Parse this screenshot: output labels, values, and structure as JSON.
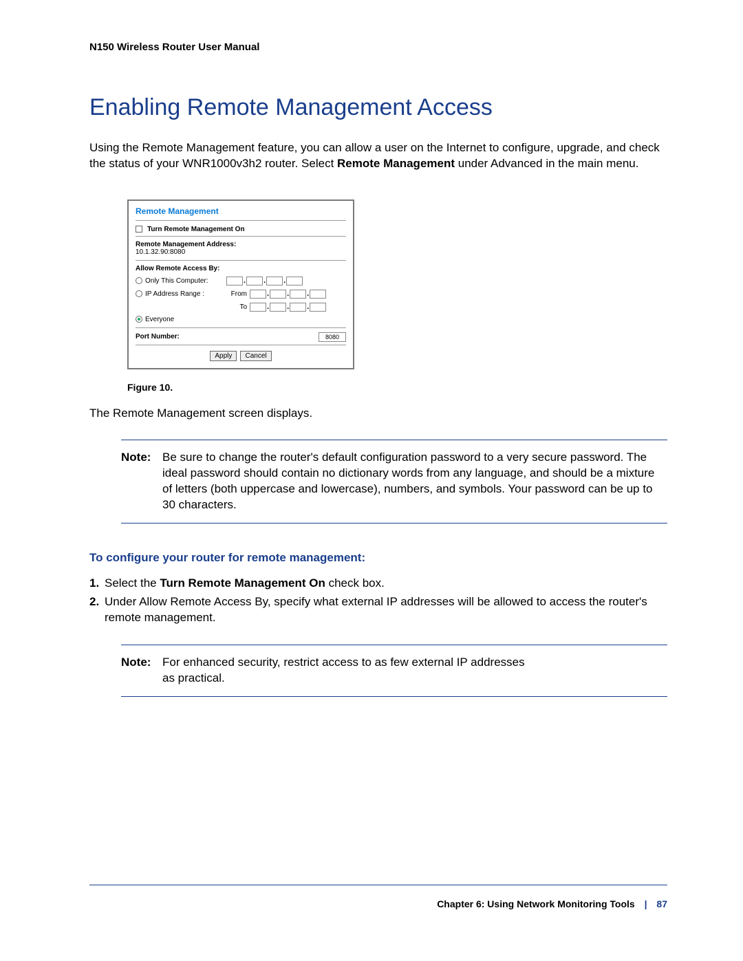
{
  "header": {
    "title": "N150 Wireless Router User Manual"
  },
  "section": {
    "title": "Enabling Remote Management Access"
  },
  "intro": {
    "pre": "Using the Remote Management feature, you can allow a user on the Internet to configure, upgrade, and check the status of your WNR1000v3h2 router. Select ",
    "bold": "Remote Management",
    "post": " under Advanced in the main menu."
  },
  "panel": {
    "title": "Remote Management",
    "turn_on_label": "Turn Remote Management On",
    "addr_label": "Remote Management Address:",
    "addr_value": "10.1.32.90:8080",
    "allow_label": "Allow Remote Access By:",
    "only_this": "Only This Computer:",
    "ip_range": "IP Address Range :",
    "from_label": "From",
    "to_label": "To",
    "everyone": "Everyone",
    "port_label": "Port Number:",
    "port_value": "8080",
    "apply": "Apply",
    "cancel": "Cancel"
  },
  "figure": {
    "caption": "Figure 10."
  },
  "body_line": "The Remote Management screen displays.",
  "note1": {
    "label": "Note:",
    "text": "Be sure to change the router's default configuration password to a very secure password. The ideal password should contain no dictionary words from any language, and should be a mixture of letters (both uppercase and lowercase), numbers, and symbols. Your password can be up to 30 characters."
  },
  "subhead": "To configure your router for remote management:",
  "steps": [
    {
      "num": "1.",
      "pre": "Select the ",
      "bold": "Turn Remote Management On",
      "post": " check box."
    },
    {
      "num": "2.",
      "pre": "Under Allow Remote Access By, specify what external IP addresses will be allowed to access the router's remote management.",
      "bold": "",
      "post": ""
    }
  ],
  "note2": {
    "label": "Note:",
    "line1": "For enhanced security, restrict access to as few external IP addresses",
    "line2": "as practical."
  },
  "footer": {
    "chapter": "Chapter 6:  Using Network Monitoring Tools",
    "sep": "|",
    "page": "87"
  }
}
